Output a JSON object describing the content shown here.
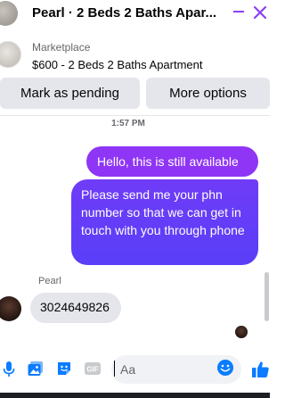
{
  "header": {
    "title": "Pearl · 2 Beds 2 Baths Apar...",
    "avatar_icon": "listing-thumbnail",
    "minimize_icon": "minimize-icon",
    "close_icon": "close-icon",
    "accent": "#8a3ffc"
  },
  "listing": {
    "label": "Marketplace",
    "name": "$600 - 2 Beds 2 Baths Apartment"
  },
  "actions": {
    "pending_label": "Mark as pending",
    "more_label": "More options"
  },
  "conversation": {
    "timestamp": "1:57 PM",
    "outgoing": [
      "Hello, this is still available",
      "Please send me your phn number so that we can get in touch with you through phone"
    ],
    "incoming_sender": "Pearl",
    "incoming": [
      "3024649826"
    ],
    "outgoing_colors": [
      "#8f35f5",
      "#5a3ef8"
    ],
    "incoming_color": "#e4e6eb"
  },
  "composer": {
    "placeholder": "Aa",
    "icons": [
      "microphone-icon",
      "image-icon",
      "sticker-icon",
      "gif-icon",
      "emoji-icon",
      "like-icon"
    ],
    "icon_color": "#0a7cff"
  }
}
